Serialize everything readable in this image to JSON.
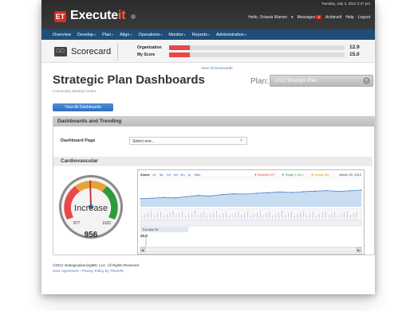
{
  "header": {
    "logo_badge": "ET",
    "logo_text": "Execute",
    "logo_accent": "it",
    "datetime": "Tuesday, July 3, 2012 2:47 pm",
    "greeting": "Hello, Octavia Warren",
    "messages_label": "Messages",
    "messages_count": "4",
    "achieveit_label": "AchieveIt",
    "help_label": "Help",
    "logout_label": "Logout"
  },
  "nav": {
    "items": [
      "Overview",
      "Develop",
      "Plan",
      "Align",
      "Operations",
      "Monitor",
      "Reports",
      "Administration"
    ]
  },
  "scorecard": {
    "icon": "□□",
    "title": "Scorecard",
    "organization_label": "Organization",
    "myscore_label": "My Score",
    "organization_value": "12.9",
    "myscore_value": "15.0",
    "organization_fill": 0.12,
    "myscore_fill": 0.12,
    "view_all_label": "View All Scorecards"
  },
  "page": {
    "title": "Strategic Plan Dashboards",
    "subtitle": "Community Medical Center",
    "plan_label": "Plan:",
    "plan_value": "2012 Strategic Plan",
    "view_all_dashboards": "View All Dashboards"
  },
  "panel": {
    "title": "Dashboards and Trending",
    "dashboard_page_label": "Dashboard Page",
    "dashboard_page_value": "Select one..."
  },
  "cardio": {
    "title": "Cardiovascular",
    "gauge_label": "Increase",
    "gauge_min": "877",
    "gauge_max": "1032",
    "gauge_value": "956"
  },
  "chart_data": {
    "type": "line",
    "title": "",
    "zoom_label": "Zoom:",
    "zoom_options": [
      "1d",
      "5d",
      "1m",
      "3m",
      "6m",
      "1y",
      "Max"
    ],
    "legend": [
      {
        "label": "Baseline:877",
        "color": "#e84848"
      },
      {
        "label": "Target 1.03 k",
        "color": "#3c8a3c"
      },
      {
        "label": "Actual:381",
        "color": "#e08a1a"
      }
    ],
    "date_label": "March 30, 2012",
    "tooltip_date": "Thu Mar 29",
    "tooltip_value": "20.9",
    "series": [
      {
        "values": [
          0.3,
          0.32,
          0.35,
          0.33,
          0.38,
          0.42,
          0.4,
          0.45,
          0.48,
          0.47,
          0.5,
          0.52,
          0.55,
          0.53,
          0.56,
          0.58,
          0.6,
          0.57,
          0.59,
          0.62
        ]
      }
    ]
  },
  "footer": {
    "copyright": "©2012 strategicplanningMD, LLC. All Rights Reserved",
    "user_agreement": "User Agreement",
    "privacy": "Privacy Policy by TRUSTe"
  },
  "colors": {
    "accent": "#1f4e78",
    "button": "#2f6fc0",
    "bar_fill": "#e84848"
  }
}
